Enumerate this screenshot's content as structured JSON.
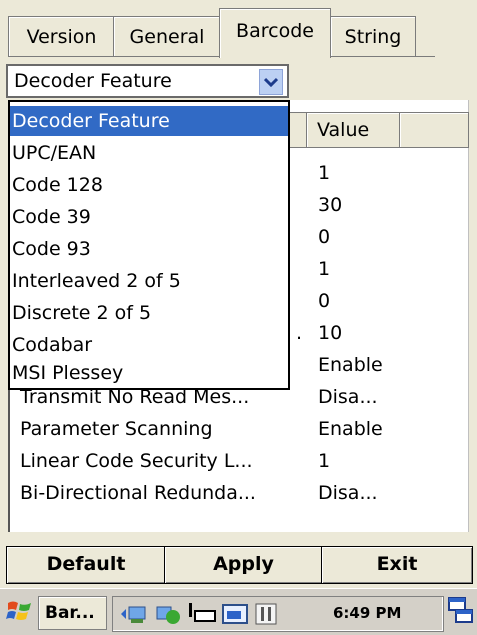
{
  "tabs": [
    {
      "label": "Version"
    },
    {
      "label": "General"
    },
    {
      "label": "Barcode",
      "active": true
    },
    {
      "label": "String"
    }
  ],
  "combo": {
    "value": "Decoder Feature"
  },
  "dropdown": {
    "options": [
      "Decoder Feature",
      "UPC/EAN",
      "Code 128",
      "Code 39",
      "Code 93",
      "Interleaved 2 of 5",
      "Discrete 2 of 5",
      "Codabar",
      "MSI Plessey"
    ],
    "selected_index": 0
  },
  "list": {
    "header_value": "Value",
    "rows": [
      {
        "name": "",
        "value": "1"
      },
      {
        "name": "",
        "value": "30"
      },
      {
        "name": "",
        "value": "0"
      },
      {
        "name": "",
        "value": "1"
      },
      {
        "name": "",
        "value": "0"
      },
      {
        "name": ".",
        "value": "10"
      },
      {
        "name": "",
        "value": "Enable"
      },
      {
        "name": "Transmit No Read Mes...",
        "value": "Disa..."
      },
      {
        "name": "Parameter Scanning",
        "value": "Enable"
      },
      {
        "name": "Linear Code Security L...",
        "value": "1"
      },
      {
        "name": "Bi-Directional Redunda...",
        "value": "Disa..."
      }
    ]
  },
  "buttons": {
    "default": "Default",
    "apply": "Apply",
    "exit": "Exit"
  },
  "taskbar": {
    "app": "Bar...",
    "clock": "6:49 PM"
  },
  "colors": {
    "selection": "#316ac5",
    "window": "#ece9d8"
  }
}
